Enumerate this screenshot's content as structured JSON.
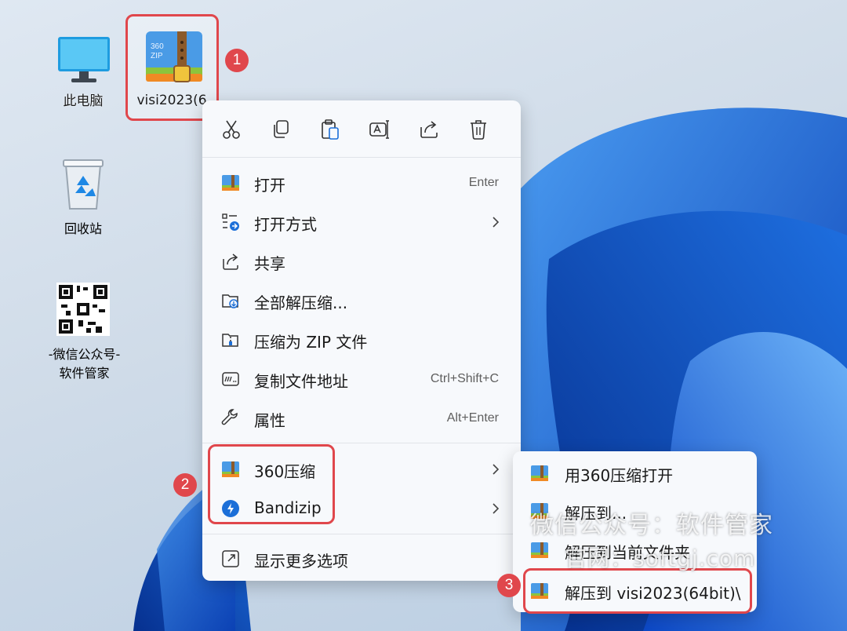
{
  "desktop": {
    "icons": [
      {
        "label": "此电脑",
        "icon": "computer-icon"
      },
      {
        "label": "visi2023(6",
        "icon": "360zip-archive-icon",
        "icon_text": "360 ZIP"
      },
      {
        "label": "回收站",
        "icon": "recycle-bin-icon"
      },
      {
        "label": "-微信公众号-",
        "label2": "软件管家",
        "icon": "qr-code-icon"
      }
    ]
  },
  "steps": [
    "1",
    "2",
    "3"
  ],
  "context_menu": {
    "toolbar": [
      "cut-icon",
      "copy-icon",
      "paste-icon",
      "rename-icon",
      "share-icon",
      "delete-icon"
    ],
    "items": [
      {
        "label": "打开",
        "shortcut": "Enter",
        "icon": "360zip-icon"
      },
      {
        "label": "打开方式",
        "icon": "open-with-icon",
        "submenu": true
      },
      {
        "label": "共享",
        "icon": "share-icon"
      },
      {
        "label": "全部解压缩...",
        "icon": "extract-all-icon"
      },
      {
        "label": "压缩为 ZIP 文件",
        "icon": "zip-icon"
      },
      {
        "label": "复制文件地址",
        "shortcut": "Ctrl+Shift+C",
        "icon": "copy-path-icon"
      },
      {
        "label": "属性",
        "shortcut": "Alt+Enter",
        "icon": "wrench-icon"
      },
      {
        "label": "360压缩",
        "icon": "360zip-icon",
        "submenu": true
      },
      {
        "label": "Bandizip",
        "icon": "bandizip-icon",
        "submenu": true
      },
      {
        "label": "显示更多选项",
        "icon": "more-options-icon"
      }
    ]
  },
  "submenu": {
    "items": [
      {
        "label": "用360压缩打开"
      },
      {
        "label": "解压到..."
      },
      {
        "label": "解压到当前文件夹"
      },
      {
        "label": "解压到 visi2023(64bit)\\"
      }
    ]
  },
  "watermark": {
    "line1": "微信公众号：软件管家",
    "line2": "官网：softgj.com"
  },
  "colors": {
    "highlight": "#e0474c",
    "menu_bg": "#f7f9fc",
    "accent": "#1c6fd8"
  }
}
